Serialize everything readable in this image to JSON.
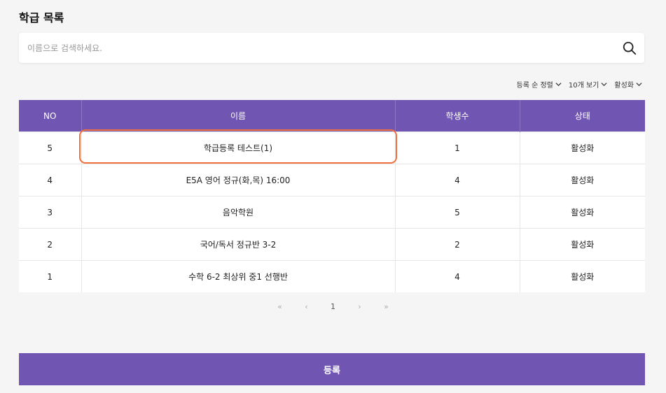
{
  "header": {
    "title": "학급 목록"
  },
  "search": {
    "placeholder": "이름으로 검색하세요.",
    "icon": "search-icon"
  },
  "filters": [
    {
      "label": "등록 순 정렬"
    },
    {
      "label": "10개 보기"
    },
    {
      "label": "활성화"
    }
  ],
  "table": {
    "columns": [
      "NO",
      "이름",
      "학생수",
      "상태"
    ],
    "rows": [
      {
        "no": "5",
        "name": "학급등록 테스트(1)",
        "students": "1",
        "status": "활성화"
      },
      {
        "no": "4",
        "name": "E5A 영어 정규(화,목) 16:00",
        "students": "4",
        "status": "활성화"
      },
      {
        "no": "3",
        "name": "음악학원",
        "students": "5",
        "status": "활성화"
      },
      {
        "no": "2",
        "name": "국어/독서 정규반 3-2",
        "students": "2",
        "status": "활성화"
      },
      {
        "no": "1",
        "name": "수학 6-2 최상위 중1 선행반",
        "students": "4",
        "status": "활성화"
      }
    ]
  },
  "pagination": {
    "first": "«",
    "prev": "‹",
    "current": "1",
    "next": "›",
    "last": "»"
  },
  "footer": {
    "register_label": "등록"
  },
  "colors": {
    "accent": "#7155b2",
    "highlight": "#f07040"
  }
}
